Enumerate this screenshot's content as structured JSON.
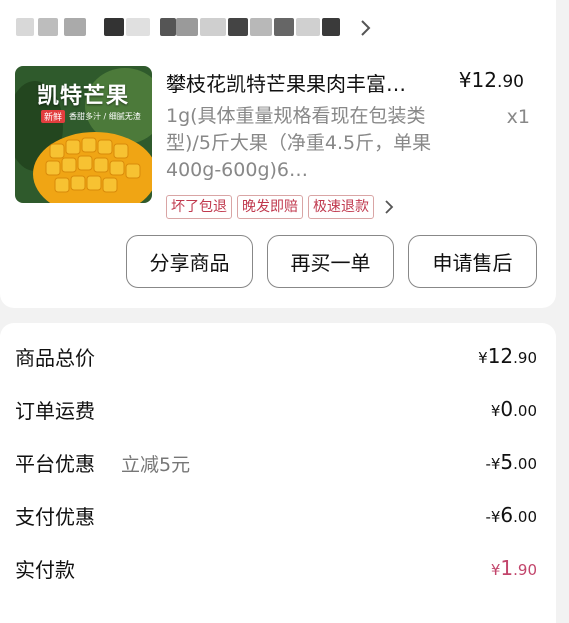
{
  "store": {
    "name_obscured": true
  },
  "product": {
    "image_title": "凯特芒果",
    "image_tag": "新鲜",
    "image_sub": "香甜多汁 / 细腻无渣",
    "title": "攀枝花凯特芒果果肉丰富…",
    "price_symbol": "¥",
    "price_int": "12",
    "price_dec": ".90",
    "spec": "1g(具体重量规格看现在包装类型)/5斤大果（净重4.5斤，单果400g-600g)6…",
    "quantity": "x1",
    "tags": [
      "坏了包退",
      "晚发即赔",
      "极速退款"
    ]
  },
  "actions": {
    "share": "分享商品",
    "rebuy": "再买一单",
    "aftersale": "申请售后"
  },
  "summary": {
    "total": {
      "label": "商品总价",
      "cur": "¥",
      "int": "12",
      "dec": ".90"
    },
    "shipping": {
      "label": "订单运费",
      "cur": "¥",
      "int": "0",
      "dec": ".00"
    },
    "platform": {
      "label": "平台优惠",
      "note": "立减5元",
      "cur": "-¥",
      "int": "5",
      "dec": ".00"
    },
    "payment": {
      "label": "支付优惠",
      "cur": "-¥",
      "int": "6",
      "dec": ".00"
    },
    "paid": {
      "label": "实付款",
      "cur": "¥",
      "int": "1",
      "dec": ".90"
    }
  },
  "colors": {
    "accent": "#c2456b",
    "tag_text": "#c0394e",
    "background": "#f2f2f2"
  }
}
